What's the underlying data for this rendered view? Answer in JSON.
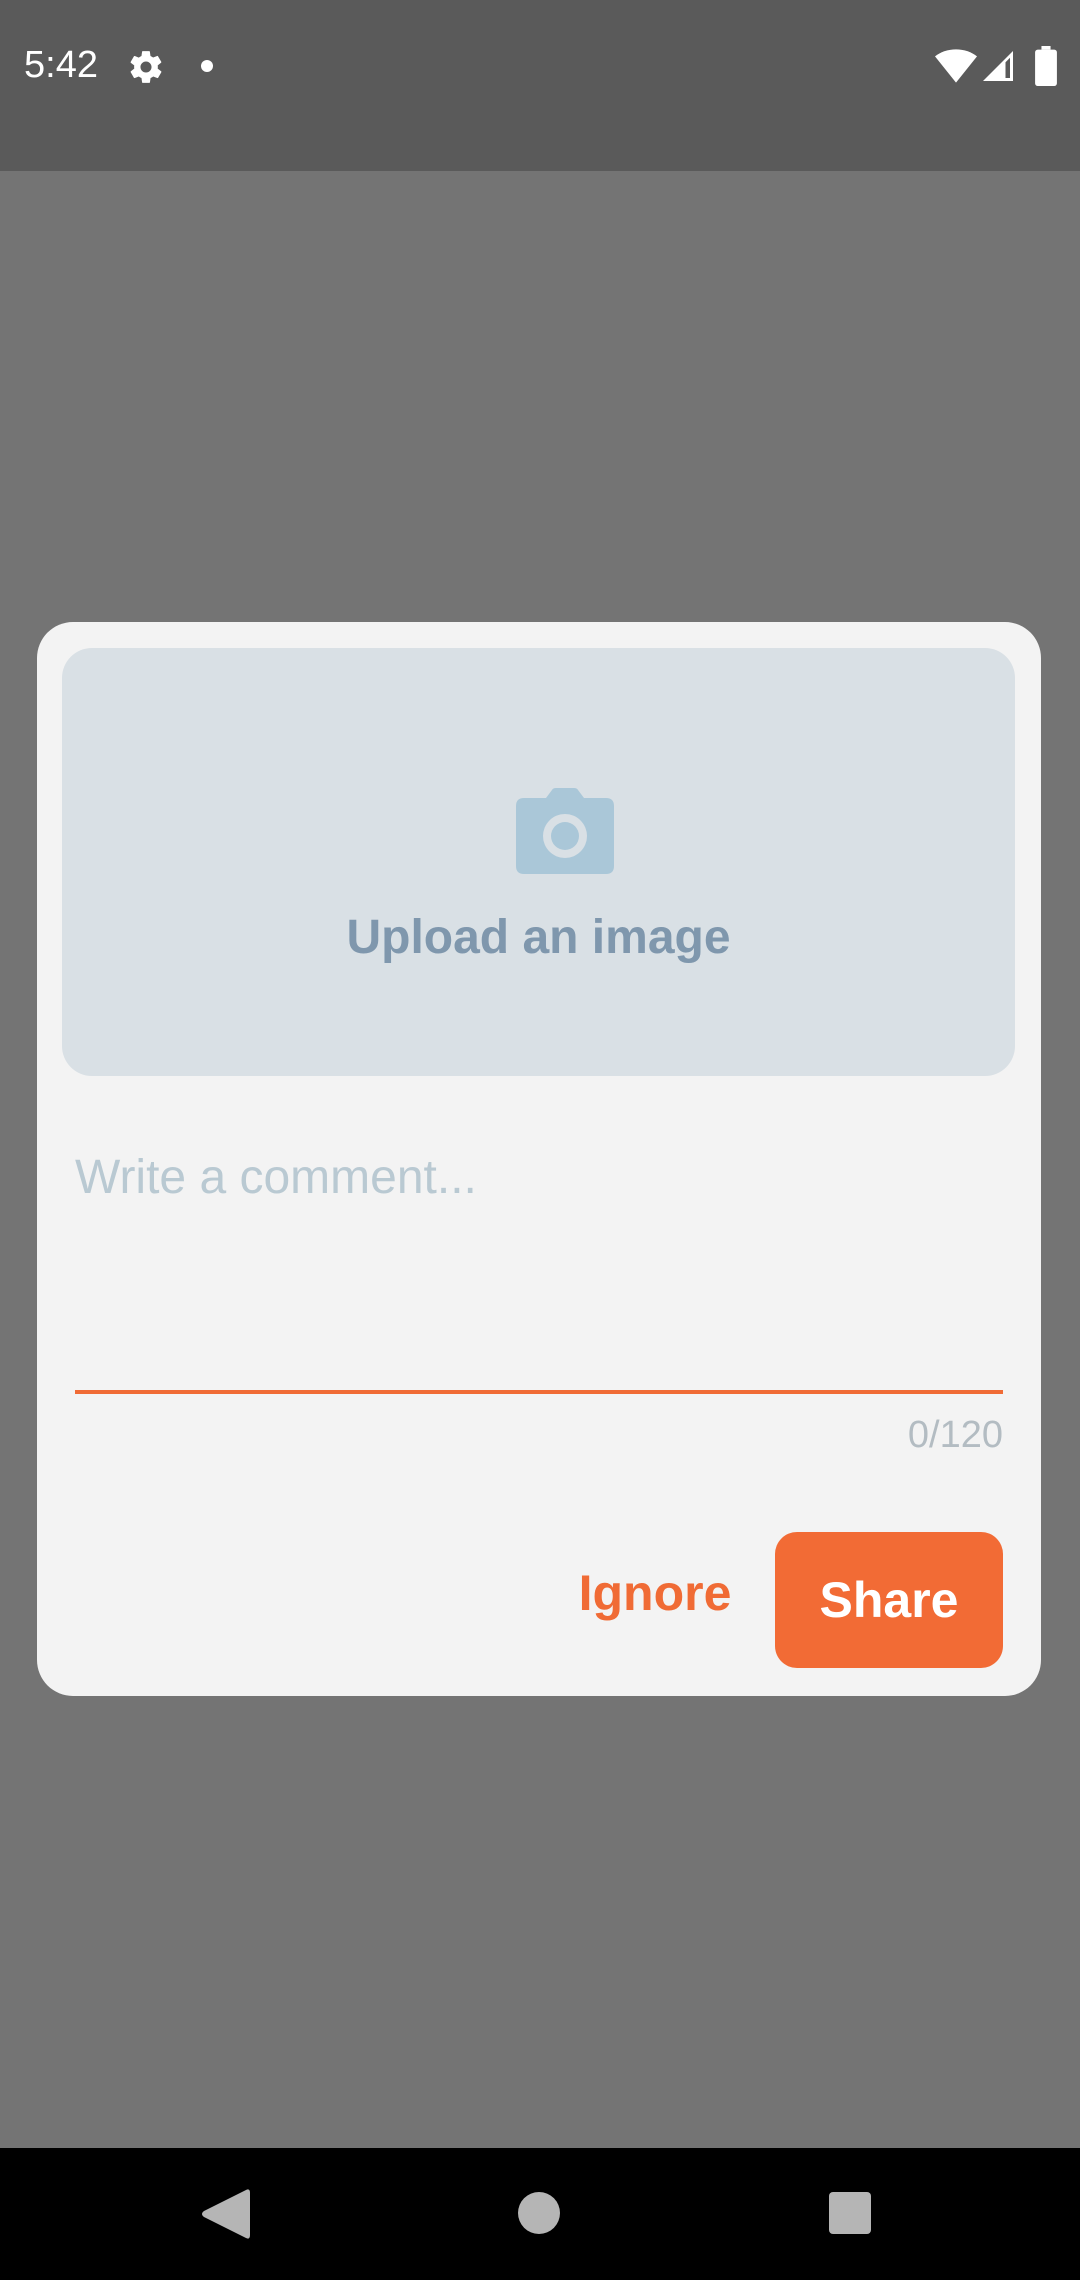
{
  "status_bar": {
    "time": "5:42",
    "icons": [
      "gear-icon",
      "notification-dot-icon",
      "wifi-icon",
      "signal-icon",
      "battery-icon"
    ]
  },
  "dialog": {
    "upload": {
      "icon": "camera-icon",
      "label": "Upload an image"
    },
    "comment": {
      "placeholder": "Write a comment...",
      "value": "",
      "counter": "0/120"
    },
    "buttons": {
      "ignore_label": "Ignore",
      "share_label": "Share"
    }
  },
  "nav_bar": {
    "icons": [
      "back-icon",
      "home-icon",
      "recents-icon"
    ]
  },
  "colors": {
    "accent": "#f26b35",
    "status_bar": "#5a5a5a",
    "scrim": "#747474",
    "dialog_bg": "#f3f3f3",
    "upload_bg": "#d9e0e5",
    "upload_text": "#7f97ad"
  }
}
